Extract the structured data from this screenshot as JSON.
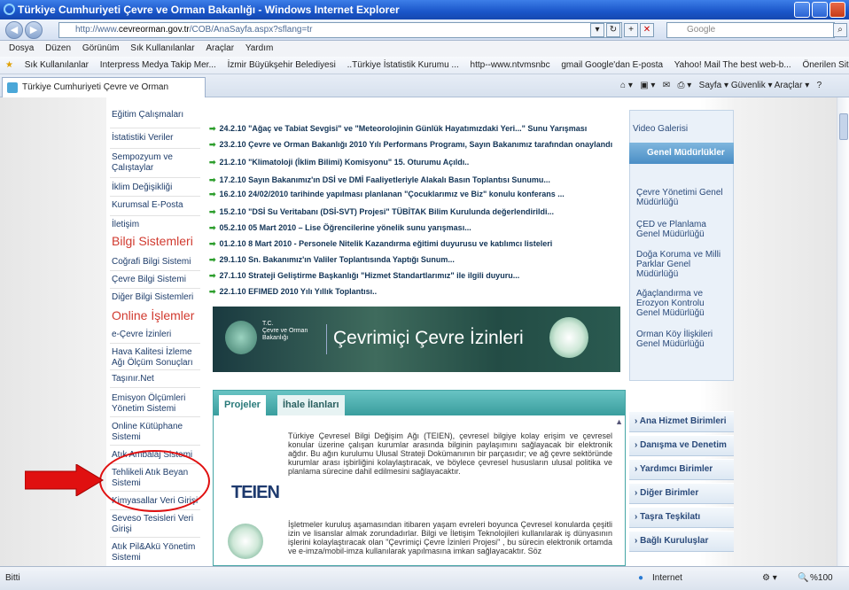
{
  "window": {
    "title": "Türkiye Cumhuriyeti Çevre ve Orman Bakanlığı - Windows Internet Explorer"
  },
  "address": {
    "url_prefix": "http://www.",
    "url_domain": "cevreorman.gov.tr",
    "url_path": "/COB/AnaSayfa.aspx?sflang=tr",
    "search_placeholder": "Google"
  },
  "menu": [
    "Dosya",
    "Düzen",
    "Görünüm",
    "Sık Kullanılanlar",
    "Araçlar",
    "Yardım"
  ],
  "favorites": [
    "Sık Kullanılanlar",
    "Interpress Medya Takip Mer...",
    "İzmir Büyükşehir Belediyesi",
    "..Türkiye İstatistik Kurumu ...",
    "http--www.ntvmsnbc",
    "gmail Google'dan E-posta",
    "Yahoo! Mail The best web-b...",
    "Önerilen Siteler"
  ],
  "tab": {
    "label": "Türkiye Cumhuriyeti Çevre ve Orman Bakanlığı"
  },
  "tabtools": "Sayfa ▾   Güvenlik ▾   Araçlar ▾",
  "left_nav": {
    "items_top": [
      "Eğitim Çalışmaları",
      "İstatistiki Veriler",
      "Sempozyum ve Çalıştaylar",
      "İklim Değişikliği",
      "Kurumsal E-Posta",
      "İletişim"
    ],
    "heading1": "Bilgi Sistemleri",
    "items_bilgi": [
      "Coğrafi Bilgi Sistemi",
      "Çevre Bilgi Sistemi",
      "Diğer Bilgi Sistemleri"
    ],
    "heading2": "Online İşlemler",
    "items_online": [
      "e-Çevre İzinleri",
      "Hava Kalitesi İzleme Ağı Ölçüm Sonuçları",
      "Taşınır.Net",
      "Emisyon Ölçümleri Yönetim Sistemi",
      "Online Kütüphane Sistemi",
      "Atık Ambalaj Sistemi",
      "Tehlikeli Atık Beyan Sistemi",
      "Kimyasallar Veri Girişi",
      "Seveso Tesisleri Veri Girişi",
      "Atık Pil&Akü Yönetim Sistemi"
    ]
  },
  "news": [
    "24.2.10 \"Ağaç ve Tabiat Sevgisi\" ve \"Meteorolojinin Günlük Hayatımızdaki Yeri...\" Sunu Yarışması",
    "23.2.10 Çevre ve Orman Bakanlığı 2010 Yılı Performans Programı, Sayın Bakanımız tarafından onaylandı",
    "21.2.10 \"Klimatoloji (İklim Bilimi) Komisyonu\" 15. Oturumu Açıldı..",
    "17.2.10 Sayın Bakanımız'ın DSİ ve DMİ Faaliyetleriyle Alakalı Basın Toplantısı Sunumu...",
    "16.2.10 24/02/2010 tarihinde yapılması planlanan \"Çocuklarımız ve Biz\" konulu konferans ...",
    "15.2.10 \"DSİ Su Veritabanı (DSİ-SVT) Projesi\" TÜBİTAK Bilim Kurulunda değerlendirildi...",
    "05.2.10 05 Mart 2010 – Lise Öğrencilerine yönelik sunu yarışması...",
    "01.2.10 8 Mart 2010 - Personele Nitelik Kazandırma eğitimi duyurusu ve katılımcı listeleri",
    "29.1.10 Sn. Bakanımız'ın Valiler Toplantısında Yaptığı Sunum...",
    "27.1.10 Strateji Geliştirme Başkanlığı \"Hizmet Standartlarımız\" ile ilgili duyuru...",
    "22.1.10 EFIMED 2010 Yılı Yıllık Toplantısı.."
  ],
  "banner": {
    "tc": "T.C.",
    "org1": "Çevre ve Orman",
    "org2": "Bakanlığı",
    "title": "Çevrimiçi Çevre İzinleri"
  },
  "tabs": {
    "tab1": "Projeler",
    "tab2": "İhale İlanları"
  },
  "teien_logo": "TEIEN",
  "project1": "Türkiye Çevresel Bilgi Değişim Ağı (TEIEN), çevresel bilgiye kolay erişim ve çevresel konular üzerine çalışan kurumlar arasında bilginin paylaşımını sağlayacak bir elektronik ağdır. Bu ağın kurulumu Ulusal Strateji Dokümanının bir parçasıdır; ve ağ çevre sektöründe kurumlar arası işbirliğini kolaylaştıracak, ve böylece çevresel hususların ulusal politika ve planlama sürecine dahil edilmesini sağlayacaktır.",
  "project2": "İşletmeler kuruluş aşamasından itibaren yaşam evreleri boyunca Çevresel konularda çeşitli izin ve lisanslar almak zorundadırlar. Bilgi ve İletişim Teknolojileri kullanılarak iş dünyasının işlerini kolaylaştıracak olan \"Çevrimiçi Çevre İzinleri Projesi\" , bu sürecin elektronik ortamda ve e-imza/mobil-imza kullanılarak yapılmasına imkan sağlayacaktır. Söz",
  "right": {
    "video": "Video Galerisi",
    "gm": "Genel Müdürlükler",
    "links": [
      "Çevre Yönetimi Genel Müdürlüğü",
      "ÇED ve Planlama Genel Müdürlüğü",
      "Doğa Koruma ve Milli Parklar Genel Müdürlüğü",
      "Ağaçlandırma ve Erozyon Kontrolu Genel Müdürlüğü",
      "Orman Köy İlişkileri Genel Müdürlüğü"
    ],
    "sections": [
      "Ana Hizmet Birimleri",
      "Danışma ve Denetim",
      "Yardımcı Birimler",
      "Diğer Birimler",
      "Taşra Teşkilatı",
      "Bağlı Kuruluşlar"
    ]
  },
  "status": {
    "left": "Bitti",
    "zone": "Internet",
    "zoom": "%100"
  },
  "colors": {
    "accent": "#3a9e9e",
    "heading_red": "#d13a2f",
    "annotation_red": "#e01010"
  }
}
